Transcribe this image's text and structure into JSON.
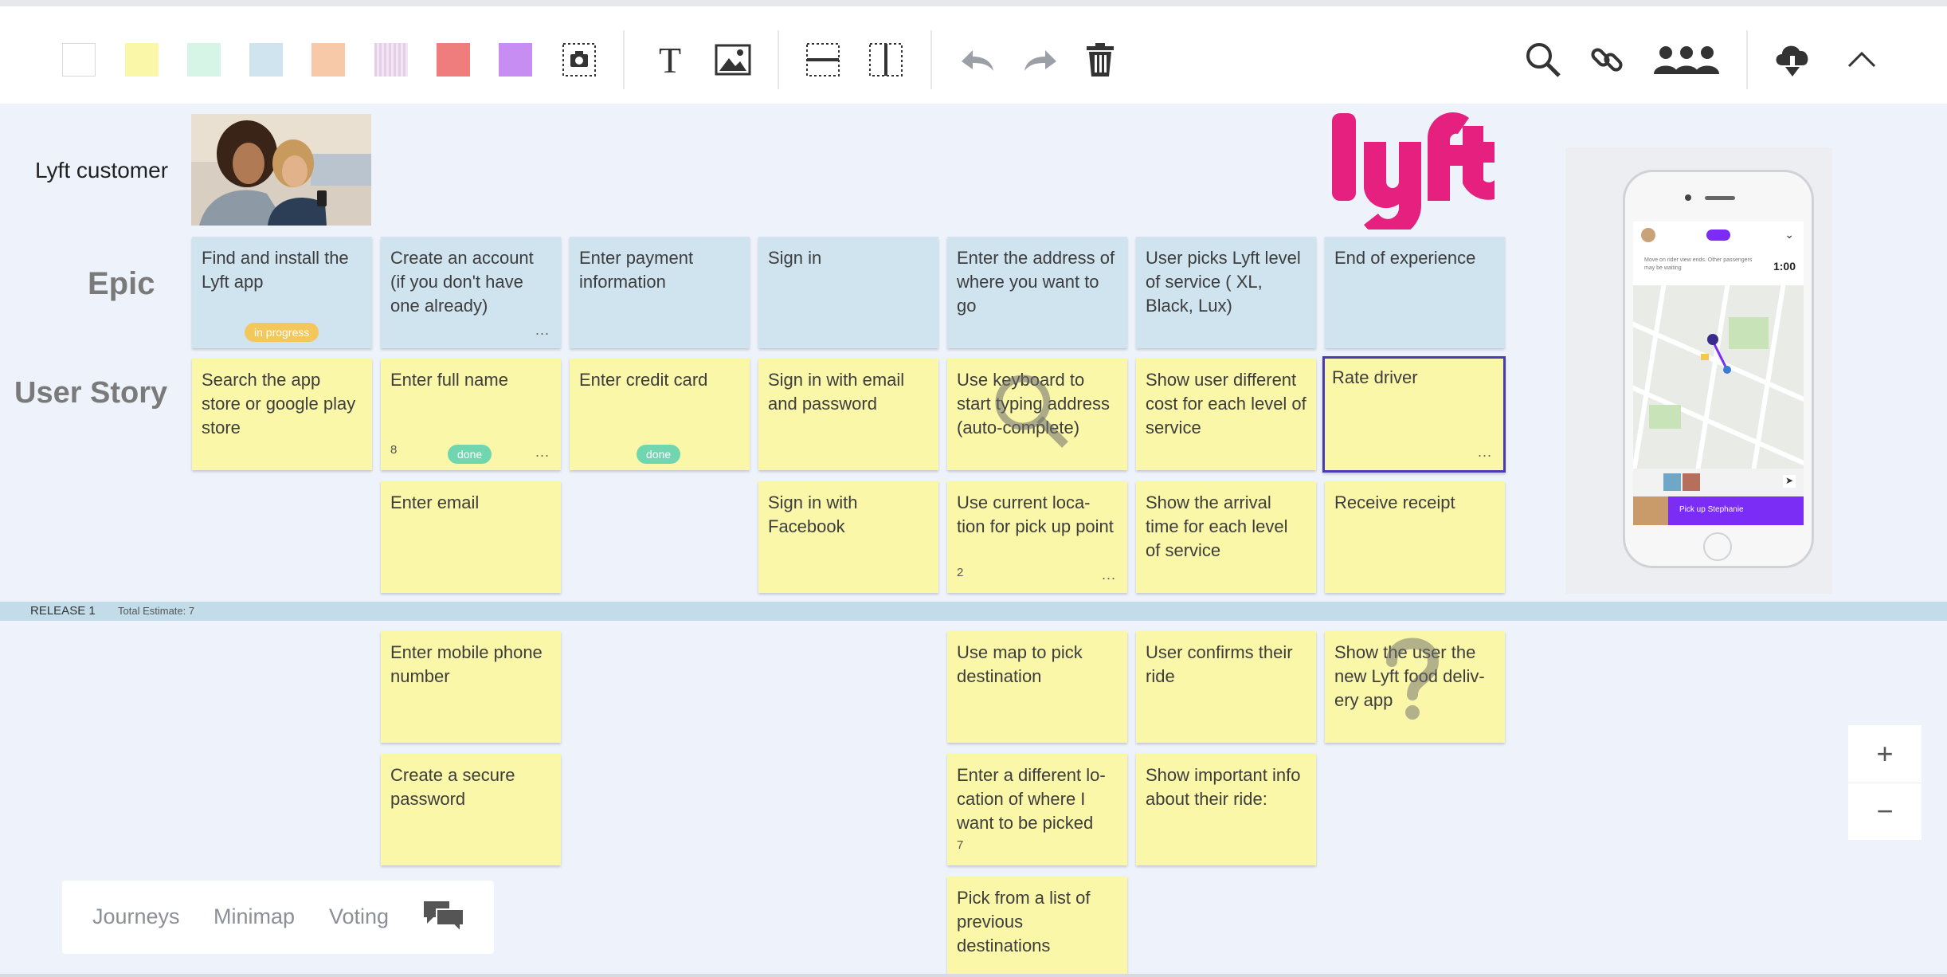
{
  "toolbar": {
    "swatches": [
      {
        "name": "white",
        "color": "#ffffff"
      },
      {
        "name": "yellow",
        "color": "#fbf7a9"
      },
      {
        "name": "mint",
        "color": "#d6f5e6"
      },
      {
        "name": "blue",
        "color": "#cfe4ef"
      },
      {
        "name": "orange",
        "color": "#f8c9a8"
      },
      {
        "name": "lilac",
        "color": "#e8d2ea"
      },
      {
        "name": "red",
        "color": "#ef7d7d"
      },
      {
        "name": "purple",
        "color": "#c88df2"
      }
    ],
    "tools_left": [
      "camera-icon",
      "text-icon",
      "image-icon",
      "horizontal-divider-icon",
      "vertical-divider-icon",
      "undo-icon",
      "redo-icon",
      "trash-icon"
    ],
    "tools_right": [
      "search-icon",
      "link-icon",
      "users-icon",
      "cloud-download-icon",
      "collapse-icon"
    ],
    "text_tool_glyph": "T"
  },
  "persona": {
    "label": "Lyft customer"
  },
  "brand": {
    "logo_text": "lyft",
    "color": "#e5207f"
  },
  "rows": {
    "epic": "Epic",
    "user_story": "User Story"
  },
  "epics": [
    {
      "text": "Find and install the Lyft app",
      "tag": "in progress"
    },
    {
      "text": "Create an account (if you don't have one already)",
      "dots": "..."
    },
    {
      "text": "Enter payment information"
    },
    {
      "text": "Sign in"
    },
    {
      "text": "Enter the address of where you want to go"
    },
    {
      "text": "User picks Lyft level of service ( XL, Black, Lux)"
    },
    {
      "text": "End of experience"
    }
  ],
  "stories_row1": [
    {
      "text": "Search the app store or google play store"
    },
    {
      "text": "Enter full name",
      "num": "8",
      "tag": "done",
      "dots": "..."
    },
    {
      "text": "Enter credit card",
      "tag": "done"
    },
    {
      "text": "Sign in with email and password"
    },
    {
      "text": "Use keyboard to start typing address (auto-complete)"
    },
    {
      "text": "Show user different cost for each level of service"
    },
    {
      "text": "Rate driver",
      "dots": "...",
      "selected": true
    }
  ],
  "stories_row2": [
    {
      "text": "Enter email"
    },
    {
      "text": "Sign in with Facebook"
    },
    {
      "text": "Use current loca-tion for pick up point",
      "num": "2",
      "dots": "..."
    },
    {
      "text": "Show the arrival time for each level of service"
    },
    {
      "text": "Receive receipt"
    }
  ],
  "release": {
    "label": "RELEASE 1",
    "estimate": "Total Estimate: 7"
  },
  "stories_below": [
    {
      "text": "Enter mobile phone number"
    },
    {
      "text": "Create a secure password"
    },
    {
      "text": "Use map to pick destination"
    },
    {
      "text": "Enter a different lo-cation of where I want to be picked",
      "num": "7"
    },
    {
      "text": "Pick from a list of previous destinations"
    },
    {
      "text": "User confirms their ride"
    },
    {
      "text": "Show important info about their ride:"
    },
    {
      "text": "Show the user the new Lyft food deliv-ery app"
    }
  ],
  "phone": {
    "eta": "1:00",
    "banner": "Move on rider view ends. Other passengers may be waiting",
    "action": "Pick up Stephanie"
  },
  "bottom_panel": {
    "items": [
      "Journeys",
      "Minimap",
      "Voting"
    ]
  },
  "zoom": {
    "in": "+",
    "out": "−"
  }
}
